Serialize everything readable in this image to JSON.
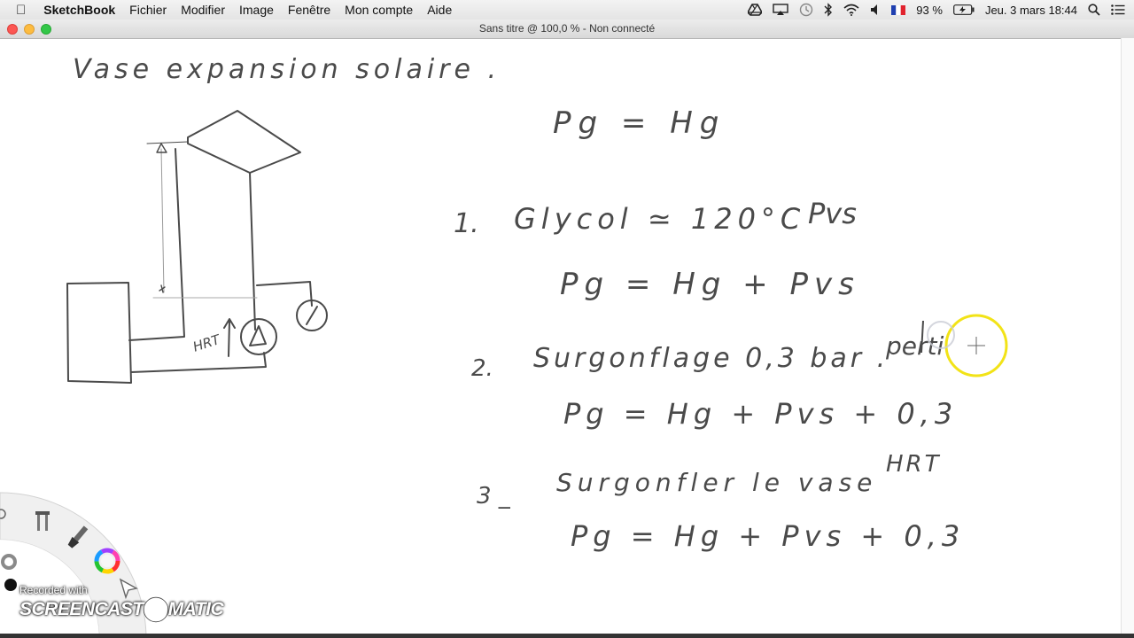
{
  "menubar": {
    "app_name": "SketchBook",
    "items": [
      "Fichier",
      "Modifier",
      "Image",
      "Fenêtre",
      "Mon compte",
      "Aide"
    ],
    "battery": "93 %",
    "datetime": "Jeu. 3 mars  18:44"
  },
  "window": {
    "title": "Sans titre @ 100,0 % - Non connecté"
  },
  "canvas": {
    "heading": "Vase expansion solaire .",
    "diagram": {
      "label_hrt": "HRT"
    },
    "equations": {
      "eq0": "Pg = Hg",
      "item1_number": "1.",
      "item1_text": "Glycol ≃ 120°C",
      "item1_pvs": "Pvs",
      "eq1": "Pg = Hg + Pvs",
      "item2_number": "2.",
      "item2_text": "Surgonflage 0,3 bar .",
      "item2_tail": "perti",
      "eq2": "Pg = Hg + Pvs + 0,3",
      "item3_number": "3 _",
      "item3_text": "Surgonfler le vase",
      "item3_tail": "HRT",
      "eq3": "Pg = Hg + Pvs + 0,3"
    }
  },
  "watermark": {
    "line1": "Recorded with",
    "brand_left": "SCREENCAST",
    "brand_right": "MATIC"
  },
  "colors": {
    "ink": "#4a4a4a",
    "cursor_ring": "#f2e317",
    "palette_ring": "#f0f0f0"
  }
}
